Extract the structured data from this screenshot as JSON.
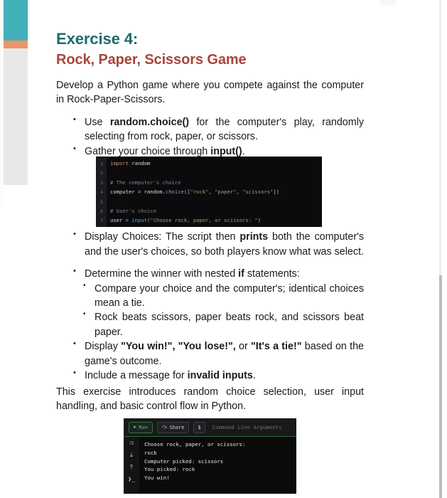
{
  "document": {
    "title": "Exercise 4:",
    "subtitle": "Rock, Paper, Scissors Game",
    "intro": "Develop a Python game where you compete against the computer in Rock-Paper-Scissors.",
    "outro": "This exercise introduces random choice selection, user input handling, and basic control flow in Python."
  },
  "colors": {
    "title_teal": "#1f6b6b",
    "subtitle_red": "#a8453a",
    "rail_teal": "#42b0b8",
    "rail_orange": "#f0936a",
    "rail_gray": "#e8e8e8",
    "body_text": "#1a1a1a"
  },
  "bullets": {
    "b1_a": "Use ",
    "b1_bold": "random.choice()",
    "b1_b": " for the computer's play, randomly selecting from rock, paper, or scissors.",
    "b2_a": "Gather your choice through ",
    "b2_bold": "input()",
    "b2_b": ".",
    "b3_a": "Display Choices: The script then ",
    "b3_bold": "prints",
    "b3_b": " both the computer's and the user's choices, so both players know what was select.",
    "b4_a": "Determine the winner with nested ",
    "b4_bold": "if",
    "b4_b": " statements:",
    "b4_sub1": "Compare your choice and the computer's; identical choices mean a tie.",
    "b4_sub2": "Rock beats scissors, paper beats rock, and scissors beat paper.",
    "b5_a": "Display ",
    "b5_bold1": "\"You win!\", \"You lose!\",",
    "b5_mid": " or ",
    "b5_bold2": "\"It's a tie!\"",
    "b5_b": " based on the game's outcome.",
    "b6_a": "Include a message for ",
    "b6_bold": "invalid inputs",
    "b6_b": "."
  },
  "code_figure": {
    "lines": [
      {
        "n": "1",
        "segments": [
          {
            "t": "import",
            "c": "tok-kw"
          },
          {
            "t": " random",
            "c": "tok-var"
          }
        ]
      },
      {
        "n": "2",
        "segments": []
      },
      {
        "n": "3",
        "segments": [
          {
            "t": "# The computer's choice",
            "c": "tok-com"
          }
        ]
      },
      {
        "n": "4",
        "segments": [
          {
            "t": "computer ",
            "c": "tok-var"
          },
          {
            "t": "= ",
            "c": "tok-op"
          },
          {
            "t": "random.",
            "c": "tok-var"
          },
          {
            "t": "choice",
            "c": "tok-fn"
          },
          {
            "t": "([",
            "c": "tok-op"
          },
          {
            "t": "\"rock\"",
            "c": "tok-str"
          },
          {
            "t": ", ",
            "c": "tok-op"
          },
          {
            "t": "\"paper\"",
            "c": "tok-str"
          },
          {
            "t": ", ",
            "c": "tok-op"
          },
          {
            "t": "\"scissors\"",
            "c": "tok-str"
          },
          {
            "t": "])",
            "c": "tok-op"
          }
        ]
      },
      {
        "n": "5",
        "segments": []
      },
      {
        "n": "6",
        "segments": [
          {
            "t": "# User's choice",
            "c": "tok-com"
          }
        ]
      },
      {
        "n": "7",
        "segments": [
          {
            "t": "user ",
            "c": "tok-var"
          },
          {
            "t": "= ",
            "c": "tok-op"
          },
          {
            "t": "input",
            "c": "tok-bi"
          },
          {
            "t": "(",
            "c": "tok-op"
          },
          {
            "t": "\"Choose rock, paper, or scissors: \"",
            "c": "tok-str"
          },
          {
            "t": ")",
            "c": "tok-op"
          }
        ]
      }
    ]
  },
  "terminal": {
    "toolbar": {
      "run_label": "Run",
      "run_icon": "play-icon",
      "share_label": "Share",
      "share_icon": "share-arrow-icon",
      "dollar_label": "$",
      "args_placeholder": "Command Line Arguments"
    },
    "rail_icons": [
      {
        "name": "copy-icon",
        "glyph": "❐"
      },
      {
        "name": "download-icon",
        "glyph": "⤓"
      },
      {
        "name": "upload-icon",
        "glyph": "⤒"
      },
      {
        "name": "terminal-prompt-icon",
        "glyph": "❯_"
      }
    ],
    "output": [
      "Choose rock, paper, or scissors:",
      "rock",
      "Computer picked: scissors",
      "You picked: rock",
      "You win!"
    ]
  }
}
